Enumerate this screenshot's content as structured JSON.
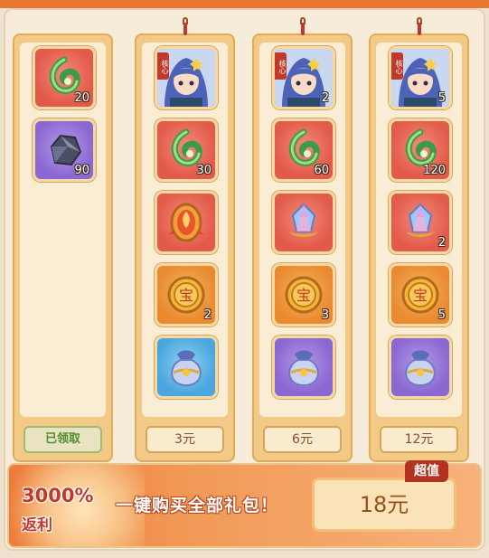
{
  "columns": [
    {
      "button_label": "已领取",
      "button_state": "claimed",
      "items": [
        {
          "icon": "jade-swirl-icon",
          "qty": "20",
          "rarity": "red"
        },
        {
          "icon": "ore-stone-icon",
          "qty": "90",
          "rarity": "purple"
        }
      ]
    },
    {
      "button_label": "3元",
      "items": [
        {
          "icon": "hero-portrait-icon",
          "qty": "",
          "rarity": "red",
          "tag": "核心"
        },
        {
          "icon": "jade-swirl-icon",
          "qty": "30",
          "rarity": "red"
        },
        {
          "icon": "phoenix-token-icon",
          "qty": "",
          "rarity": "red"
        },
        {
          "icon": "gold-coin-icon",
          "qty": "2",
          "rarity": "orange"
        },
        {
          "icon": "treasure-bag-icon",
          "qty": "",
          "rarity": "blue"
        }
      ]
    },
    {
      "button_label": "6元",
      "items": [
        {
          "icon": "hero-portrait-icon",
          "qty": "2",
          "rarity": "red",
          "tag": "核心"
        },
        {
          "icon": "jade-swirl-icon",
          "qty": "60",
          "rarity": "red"
        },
        {
          "icon": "crystal-gem-icon",
          "qty": "",
          "rarity": "red"
        },
        {
          "icon": "gold-coin-icon",
          "qty": "3",
          "rarity": "orange"
        },
        {
          "icon": "treasure-bag-icon",
          "qty": "",
          "rarity": "purple"
        }
      ]
    },
    {
      "button_label": "12元",
      "items": [
        {
          "icon": "hero-portrait-icon",
          "qty": "5",
          "rarity": "red",
          "tag": "核心"
        },
        {
          "icon": "jade-swirl-icon",
          "qty": "120",
          "rarity": "red"
        },
        {
          "icon": "crystal-gem-icon",
          "qty": "2",
          "rarity": "red"
        },
        {
          "icon": "gold-coin-icon",
          "qty": "5",
          "rarity": "orange"
        },
        {
          "icon": "treasure-bag-icon",
          "qty": "",
          "rarity": "purple"
        }
      ]
    }
  ],
  "banner": {
    "rebate_percent": "3000%",
    "rebate_label": "返利",
    "text": "一键购买全部礼包！",
    "price_label": "18元",
    "badge": "超值"
  },
  "colors": {
    "accent_orange": "#e9762f",
    "rarity_red": "#e25a49",
    "rarity_purple": "#8a67d1",
    "rarity_orange": "#e98a2f",
    "rarity_blue": "#4aa6de"
  }
}
